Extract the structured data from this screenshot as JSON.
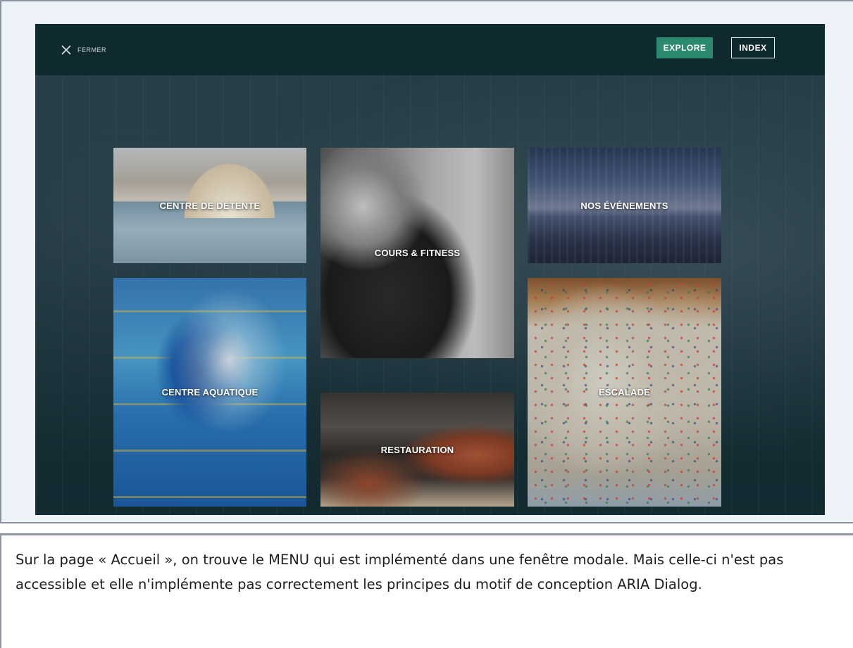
{
  "modal": {
    "close_label": "FERMER",
    "buttons": {
      "explore_label": "EXPLORE",
      "index_label": "INDEX"
    },
    "tiles": [
      {
        "label": "CENTRE DE DÉTENTE"
      },
      {
        "label": "COURS & FITNESS"
      },
      {
        "label": "NOS ÉVÉNEMENTS"
      },
      {
        "label": "CENTRE AQUATIQUE"
      },
      {
        "label": "RESTAURATION"
      },
      {
        "label": "ESCALADE"
      }
    ],
    "colors": {
      "topbar": "#0f2a2f",
      "explore_button": "#2b8a6d"
    }
  },
  "caption": {
    "text": "Sur la page « Accueil », on trouve le MENU qui est implémenté dans une fenêtre modale. Mais celle-ci n'est pas accessible et elle n'implémente pas correctement les principes du motif de conception ARIA Dialog."
  }
}
